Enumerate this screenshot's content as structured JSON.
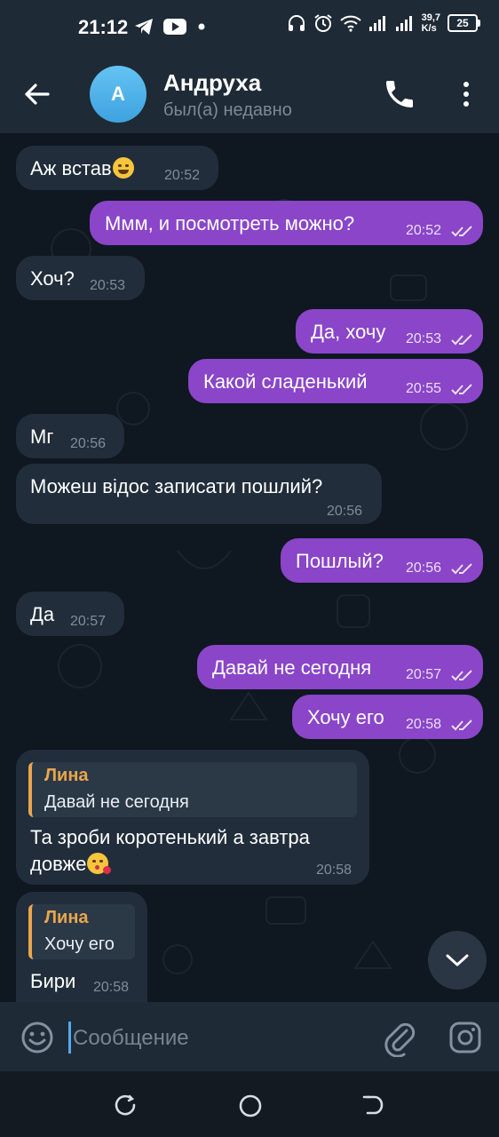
{
  "status_bar": {
    "time": "21:12",
    "speed_value": "39,7",
    "speed_unit": "K/s",
    "battery": "25",
    "icons": [
      "telegram-icon",
      "youtube-icon",
      "dot-icon",
      "headphones-icon",
      "alarm-icon",
      "wifi-icon",
      "signal-icon",
      "signal-icon"
    ]
  },
  "header": {
    "avatar_letter": "A",
    "name": "Андруха",
    "status": "был(а) недавно",
    "avatar_color": "#4fb3ea"
  },
  "messages": [
    {
      "dir": "in",
      "text": "Аж встав",
      "emoji": "grinning-sweat",
      "time": "20:52"
    },
    {
      "dir": "out",
      "text": "Ммм, и посмотреть можно?",
      "time": "20:52",
      "read": true
    },
    {
      "dir": "in",
      "text": "Хоч?",
      "time": "20:53"
    },
    {
      "dir": "out",
      "text": "Да, хочу",
      "time": "20:53",
      "read": true
    },
    {
      "dir": "out",
      "text": "Какой сладенький",
      "time": "20:55",
      "read": true
    },
    {
      "dir": "in",
      "text": "Мг",
      "time": "20:56"
    },
    {
      "dir": "in",
      "text": "Можеш відос записати пошлий?",
      "time": "20:56"
    },
    {
      "dir": "out",
      "text": "Пошлый?",
      "time": "20:56",
      "read": true
    },
    {
      "dir": "in",
      "text": "Да",
      "time": "20:57"
    },
    {
      "dir": "out",
      "text": "Давай не сегодня",
      "time": "20:57",
      "read": true
    },
    {
      "dir": "out",
      "text": "Хочу его",
      "time": "20:58",
      "read": true
    },
    {
      "dir": "in",
      "reply_name": "Лина",
      "reply_text": "Давай не сегодня",
      "text_line1": "Та зроби коротенький а завтра",
      "text_line2": "довже",
      "emoji": "kissing-heart",
      "time": "20:58"
    },
    {
      "dir": "in",
      "reply_name": "Лина",
      "reply_text": "Хочу его",
      "text": "Бири",
      "time": "20:58"
    }
  ],
  "input": {
    "placeholder": "Сообщение"
  },
  "colors": {
    "outgoing": "#8a45c9",
    "incoming": "#212d3b",
    "header": "#1e2a36",
    "reply_accent": "#e9a64e"
  }
}
